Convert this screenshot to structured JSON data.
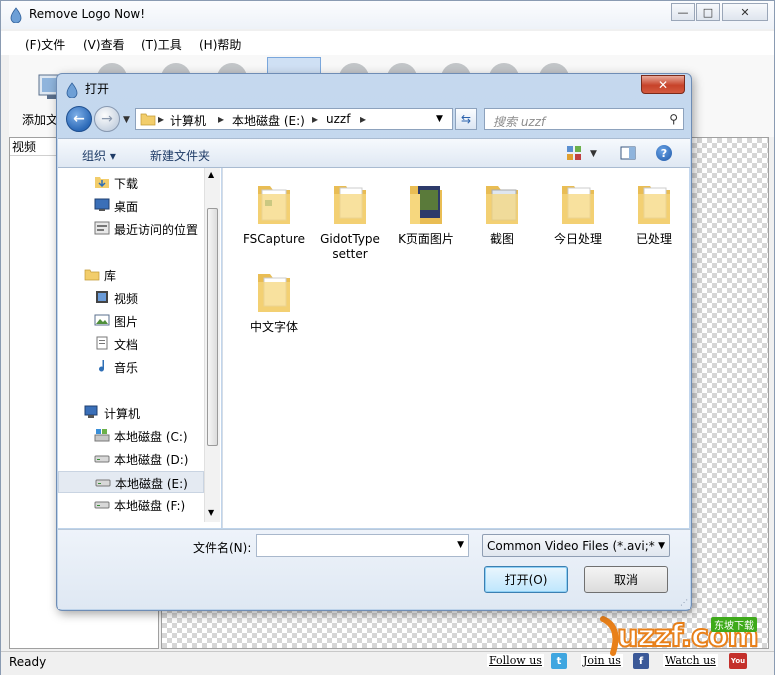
{
  "app": {
    "title": "Remove Logo Now!",
    "menu": [
      "(F)文件",
      "(V)查看",
      "(T)工具",
      "(H)帮助"
    ],
    "toolbar": {
      "add_label": "添加文"
    },
    "left_panel": {
      "header": "视频"
    },
    "status": {
      "text": "Ready"
    },
    "social": {
      "follow": "Follow us",
      "join": "Join us",
      "watch": "Watch us"
    },
    "watermark": {
      "text": "uzzf.com",
      "badge": "东坡下载"
    },
    "window_buttons": {
      "minimize": "—",
      "maximize": "□",
      "close": "✕"
    }
  },
  "dialog": {
    "title": "打开",
    "close": "✕",
    "address": [
      "计算机",
      "本地磁盘 (E:)",
      "uzzf"
    ],
    "search_placeholder": "搜索 uzzf",
    "commands": {
      "organize": "组织 ▾",
      "new_folder": "新建文件夹",
      "help": "?"
    },
    "nav": {
      "favorites": [
        "下载",
        "桌面",
        "最近访问的位置"
      ],
      "libraries": {
        "label": "库",
        "items": [
          "视频",
          "图片",
          "文档",
          "音乐"
        ]
      },
      "computer": {
        "label": "计算机",
        "items": [
          "本地磁盘 (C:)",
          "本地磁盘 (D:)",
          "本地磁盘 (E:)",
          "本地磁盘 (F:)"
        ]
      },
      "selected": "本地磁盘 (E:)"
    },
    "files": [
      {
        "name": "FSCapture"
      },
      {
        "name": "GidotType setter"
      },
      {
        "name": "K页面图片"
      },
      {
        "name": "截图"
      },
      {
        "name": "今日处理"
      },
      {
        "name": "已处理"
      },
      {
        "name": "中文字体"
      }
    ],
    "filename_label": "文件名(N):",
    "filename_value": "",
    "filetype": "Common Video Files (*.avi;*.",
    "open_button": "打开(O)",
    "cancel_button": "取消"
  },
  "colors": {
    "accent": "#3c7fb1",
    "folder": "#f2cd6b",
    "close_red": "#c7432a"
  }
}
